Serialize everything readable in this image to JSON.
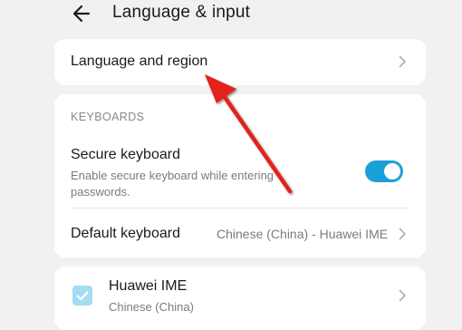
{
  "header": {
    "title": "Language & input",
    "back_icon": "arrow-left-icon"
  },
  "language_region": {
    "label": "Language and region"
  },
  "keyboards": {
    "section_label": "KEYBOARDS",
    "secure_keyboard": {
      "title": "Secure keyboard",
      "description_line1": "Enable secure keyboard while entering",
      "description_line2": "passwords.",
      "toggle_state": "on",
      "toggle_color": "#1aa0d8"
    },
    "default_keyboard": {
      "title": "Default keyboard",
      "value": "Chinese (China) - Huawei IME"
    }
  },
  "ime": {
    "title": "Huawei IME",
    "subtitle": "Chinese (China)",
    "checked": true
  },
  "annotation": {
    "arrow_color": "#e2231a",
    "icon": "red-arrow-pointer"
  },
  "colors": {
    "background": "#f1f1f1",
    "card": "#ffffff",
    "accent": "#1aa0d8"
  }
}
